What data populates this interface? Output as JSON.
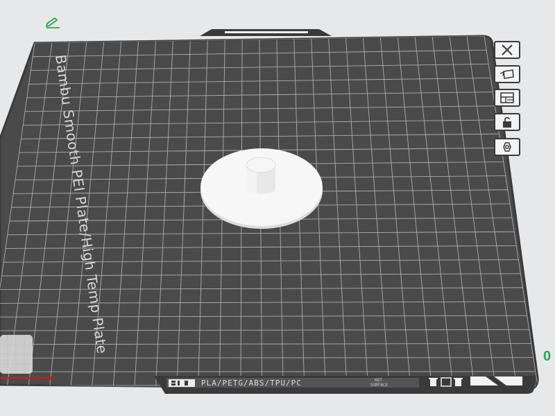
{
  "plate": {
    "label": "Bambu Smooth PEI Plate/High Temp Plate",
    "number": "0"
  },
  "strip": {
    "materials": "PLA/PETG/ABS/TPU/PC",
    "hot_line1": "HOT",
    "hot_line2": "SURFACE"
  },
  "toolbar": {
    "buttons": [
      {
        "icon": "close-icon"
      },
      {
        "icon": "auto-orient-icon"
      },
      {
        "icon": "arrange-icon"
      },
      {
        "icon": "lock-icon"
      },
      {
        "icon": "settings-icon"
      }
    ]
  },
  "colors": {
    "plate": "#4a4a4b",
    "frame": "#3a3a3a",
    "grid_line": "#cfcfcf",
    "accent_green": "#1fae4a",
    "axis_red": "#d11a1a",
    "background": "#e7e8ea"
  }
}
